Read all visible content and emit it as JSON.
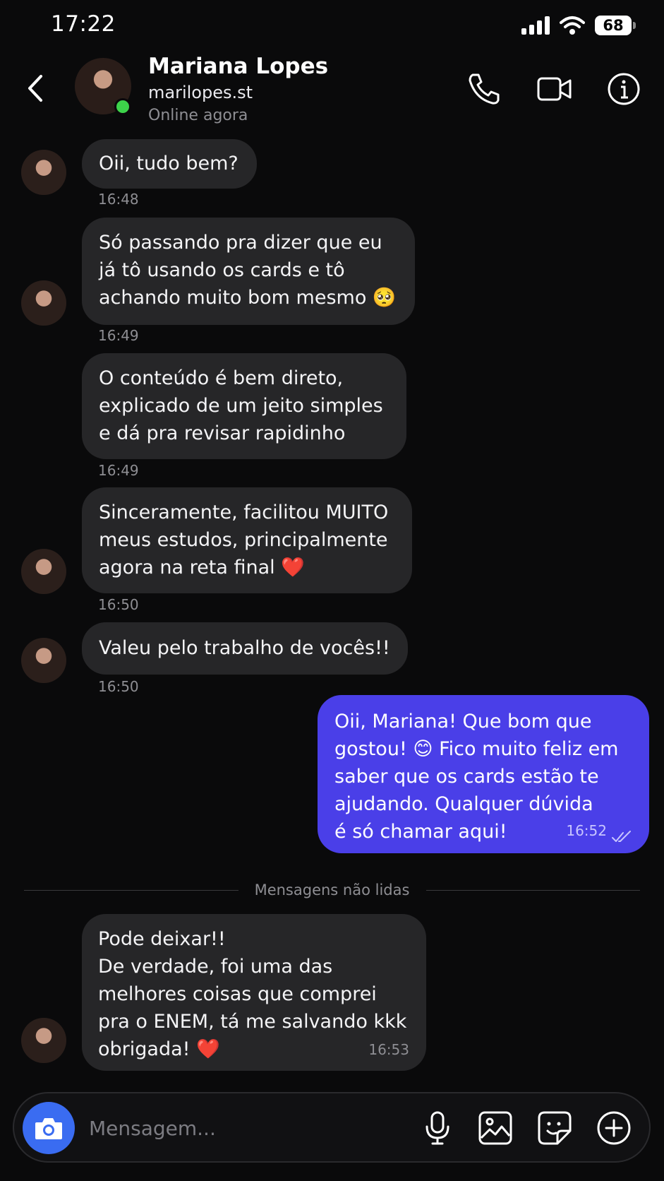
{
  "status_bar": {
    "time": "17:22",
    "battery": "68"
  },
  "header": {
    "name": "Mariana Lopes",
    "handle": "marilopes.st",
    "status": "Online agora"
  },
  "messages": [
    {
      "lines": [
        "Oii, tudo bem?"
      ],
      "time": "16:48"
    },
    {
      "lines": [
        "Só passando pra dizer que eu",
        "já tô usando os cards e tô",
        "achando muito bom mesmo 🥺"
      ],
      "time": "16:49"
    },
    {
      "lines": [
        "O conteúdo é bem direto,",
        "explicado de um jeito simples",
        "e dá pra revisar rapidinho"
      ],
      "time": "16:49"
    },
    {
      "lines": [
        "Sinceramente, facilitou MUITO",
        "meus estudos, principalmente",
        "agora na reta final ❤️"
      ],
      "time": "16:50"
    },
    {
      "lines": [
        "Valeu pelo trabalho de vocês!!"
      ],
      "time": "16:50"
    }
  ],
  "sent_message": {
    "lines": [
      "Oii, Mariana! Que bom que",
      "gostou! 😊 Fico muito feliz em",
      "saber que os cards estão te",
      "ajudando. Qualquer dúvida",
      "é só chamar aqui!"
    ],
    "time": "16:52"
  },
  "divider_label": "Mensagens não lidas",
  "last_message": {
    "lines": [
      "Pode deixar!!",
      "De verdade, foi uma das",
      "melhores coisas que comprei",
      "pra o ENEM, tá me salvando kkk",
      "obrigada! ❤️"
    ],
    "time": "16:53"
  },
  "composer": {
    "placeholder": "Mensagem..."
  },
  "colors": {
    "background": "#0a0a0b",
    "bubble_received": "#262628",
    "bubble_sent": "#4a3fe8",
    "camera_button": "#3a6cf1",
    "online": "#3dd34a"
  },
  "icons": [
    "back-arrow",
    "phone",
    "video-camera",
    "info",
    "camera",
    "microphone",
    "image",
    "sticker",
    "plus-circle",
    "double-check"
  ]
}
